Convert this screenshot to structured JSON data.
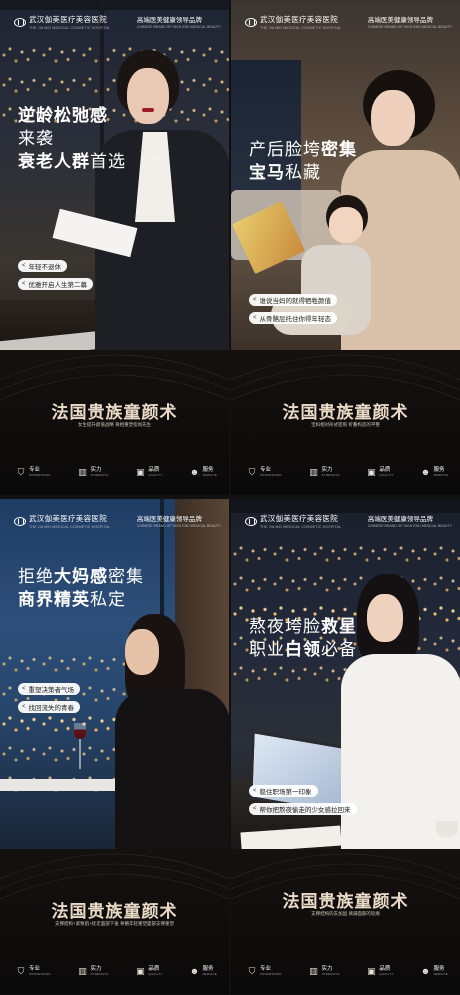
{
  "logo": {
    "name": "武汉伽美医疗美容医院",
    "sub": "THE JIA MEI MEDICAL COSMETIC HOSPITAL"
  },
  "brand": {
    "name": "高端医美健康领导品牌",
    "sub": "CHINESE BRAND OF HIGH END MEDICAL BEAUTY"
  },
  "product_title": "法国贵族童颜术",
  "features": [
    {
      "cn": "专业",
      "en": "PROFESSION",
      "icon": "shield-icon"
    },
    {
      "cn": "实力",
      "en": "STRENGTH",
      "icon": "bars-icon"
    },
    {
      "cn": "品质",
      "en": "QUALITY",
      "icon": "badge-icon"
    },
    {
      "cn": "服务",
      "en": "SERVICE",
      "icon": "person-icon"
    }
  ],
  "posters": [
    {
      "headline": [
        [
          "逆龄松弛感",
          ""
        ],
        [
          "来袭",
          ""
        ],
        [
          "衰老人群",
          "首选"
        ]
      ],
      "tags": [
        "年轻不退休",
        "优雅开启人生第二幕"
      ],
      "subtitle": "女生提升颜值战略 骨相重塑指尚先生"
    },
    {
      "headline": [
        [
          "产后脸垮",
          "密集"
        ],
        [
          "宝马",
          "私藏"
        ]
      ],
      "tags": [
        "谁说当妈的就得牺牲颜值",
        "从骨骼层托住你得年轻态"
      ],
      "subtitle": "宝妈相对形式密照 折叠构造的平整"
    },
    {
      "headline": [
        [
          "拒绝",
          "大妈感",
          "密集"
        ],
        [
          "商界精英",
          "私定"
        ]
      ],
      "tags": [
        "重塑决策者气场",
        "找回流失的青春"
      ],
      "subtitle": "支撑结构+紧致肌+抚走面部下垂 骨骼年轻重塑面部支撑重塑"
    },
    {
      "headline": [
        [
          "熬夜垮脸",
          "救星"
        ],
        [
          "职业",
          "白领",
          "必备"
        ]
      ],
      "tags": [
        "稳住职场第一印象",
        "帮你把熬夜偷走的少女感拉回来"
      ],
      "subtitle": "支撑结构的支加固 填满面部的轮廓"
    }
  ],
  "colors": {
    "title_gold": "#e8dac6",
    "tag_bg": "#ffffff",
    "band_bg": "#0e0d0d"
  }
}
